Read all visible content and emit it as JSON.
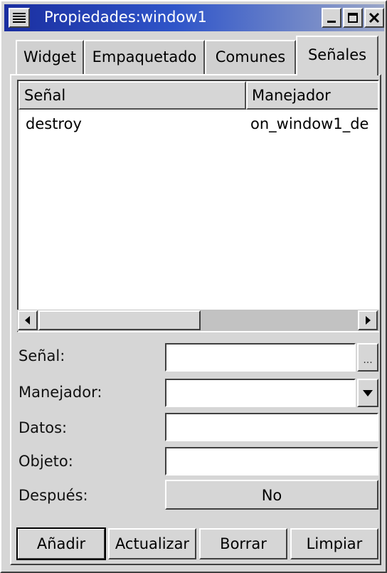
{
  "window": {
    "title": "Propiedades:window1"
  },
  "tabs": [
    {
      "label": "Widget"
    },
    {
      "label": "Empaquetado"
    },
    {
      "label": "Comunes"
    },
    {
      "label": "Señales"
    }
  ],
  "signal_list": {
    "columns": [
      "Señal",
      "Manejador"
    ],
    "rows": [
      {
        "signal": "destroy",
        "handler": "on_window1_de"
      }
    ]
  },
  "form": {
    "signal_label": "Señal:",
    "signal_value": "",
    "browse_label": "...",
    "handler_label": "Manejador:",
    "handler_value": "",
    "data_label": "Datos:",
    "data_value": "",
    "object_label": "Objeto:",
    "object_value": "",
    "after_label": "Después:",
    "after_value": "No"
  },
  "buttons": {
    "add": "Añadir",
    "update": "Actualizar",
    "delete": "Borrar",
    "clear": "Limpiar"
  },
  "icons": {
    "window_menu": "window-menu-icon",
    "minimize": "minimize-icon",
    "maximize": "maximize-icon",
    "close": "close-icon",
    "scroll_left": "arrow-left-icon",
    "scroll_right": "arrow-right-icon",
    "dropdown": "chevron-down-icon"
  },
  "colors": {
    "titlebar_start": "#1a2ea0",
    "titlebar_end": "#9aa6c8",
    "face": "#d6d6d6"
  }
}
